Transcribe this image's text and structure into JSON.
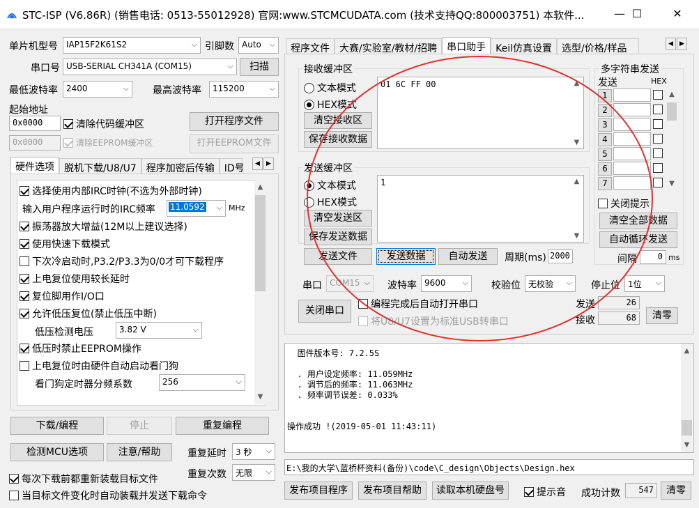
{
  "window": {
    "title": "STC-ISP (V6.86R) (销售电话: 0513-55012928) 官网:www.STCMCUDATA.com  (技术支持QQ:800003751) 本软件...",
    "min": "—",
    "max": "☐",
    "close": "✕"
  },
  "left": {
    "mcu_label": "单片机型号",
    "mcu_value": "IAP15F2K61S2",
    "pins_label": "引脚数",
    "pins_value": "Auto",
    "port_label": "串口号",
    "port_value": "USB-SERIAL CH341A (COM15)",
    "scan": "扫描",
    "min_baud_label": "最低波特率",
    "min_baud": "2400",
    "max_baud_label": "最高波特率",
    "max_baud": "115200",
    "start_addr_label": "起始地址",
    "addr1": "0x0000",
    "clear_code": "清除代码缓冲区",
    "open_prog": "打开程序文件",
    "addr2": "0x0000",
    "clear_eeprom": "清除EEPROM缓冲区",
    "open_eeprom": "打开EEPROM文件",
    "tabs": [
      "硬件选项",
      "脱机下载/U8/U7",
      "程序加密后传输",
      "ID号"
    ],
    "options": [
      {
        "label": "选择使用内部IRC时钟(不选为外部时钟)",
        "checked": true
      },
      {
        "label": "振荡器放大增益(12M以上建议选择)",
        "checked": true
      },
      {
        "label": "使用快速下载模式",
        "checked": true
      },
      {
        "label": "下次冷启动时,P3.2/P3.3为0/0才可下载程序",
        "checked": false
      },
      {
        "label": "上电复位使用较长延时",
        "checked": true
      },
      {
        "label": "复位脚用作I/O口",
        "checked": true
      },
      {
        "label": "允许低压复位(禁止低压中断)",
        "checked": true
      },
      {
        "label": "低压时禁止EEPROM操作",
        "checked": true
      },
      {
        "label": "上电复位时由硬件自动启动看门狗",
        "checked": false
      }
    ],
    "irc_label": "输入用户程序运行时的IRC频率",
    "irc_value": "11.0592",
    "irc_unit": "MHz",
    "lv_label": "低压检测电压",
    "lv_value": "3.82 V",
    "wdt_label": "看门狗定时器分频系数",
    "wdt_value": "256",
    "download": "下载/编程",
    "stop": "停止",
    "reprogram": "重复编程",
    "check_mcu": "检测MCU选项",
    "help": "注意/帮助",
    "delay_label": "重复延时",
    "delay_value": "3 秒",
    "times_label": "重复次数",
    "times_value": "无限",
    "reload": "每次下载前都重新装载目标文件",
    "auto_send": "当目标文件变化时自动装载并发送下载命令"
  },
  "right": {
    "tabs": [
      "程序文件",
      "大赛/实验室/教材/招聘",
      "串口助手",
      "Keil仿真设置",
      "选型/价格/样品"
    ],
    "recv_group": "接收缓冲区",
    "recv_text": "文本模式",
    "recv_hex": "HEX模式",
    "recv_clear": "清空接收区",
    "recv_save": "保存接收数据",
    "recv_data": "01 6C FF 00",
    "send_group": "发送缓冲区",
    "send_text": "文本模式",
    "send_hex": "HEX模式",
    "send_clear": "清空发送区",
    "send_save": "保存发送数据",
    "send_data": "1",
    "send_file": "发送文件",
    "send_data_btn": "发送数据",
    "auto_send": "自动发送",
    "period_label": "周期(ms)",
    "period_value": "2000",
    "multi_title": "多字符串发送",
    "multi_send": "发送",
    "multi_hex": "HEX",
    "multi_rows": [
      "1",
      "2",
      "3",
      "4",
      "5",
      "6",
      "7"
    ],
    "close_tip": "关闭提示",
    "clear_all": "清空全部数据",
    "auto_loop": "自动循环发送",
    "interval_label": "间隔",
    "interval_value": "0",
    "interval_unit": "ms",
    "port_label": "串口",
    "port_value": "COM15",
    "baud_label": "波特率",
    "baud_value": "9600",
    "parity_label": "校验位",
    "parity_value": "无校验",
    "stop_label": "停止位",
    "stop_value": "1位",
    "close_port": "关闭串口",
    "auto_open": "编程完成后自动打开串口",
    "usb_set": "将U8/U7设置为标准USB转串口",
    "sent_label": "发送",
    "sent_value": "26",
    "recv_label": "接收",
    "recv_value": "68",
    "reset": "清零"
  },
  "log": {
    "lines": [
      "  固件版本号: 7.2.5S",
      "",
      "  . 用户设定频率: 11.059MHz",
      "  . 调节后的频率: 11.063MHz",
      "  . 频率调节误差: 0.033%",
      "",
      "",
      "操作成功 !(2019-05-01 11:43:11)"
    ],
    "path": "E:\\我的大学\\蓝桥杯资料(备份)\\code\\C_design\\Objects\\Design.hex"
  },
  "bottom": {
    "publish_prog": "发布项目程序",
    "publish_help": "发布项目帮助",
    "read_disk": "读取本机硬盘号",
    "beep": "提示音",
    "success_label": "成功计数",
    "success_value": "547",
    "reset": "清零"
  }
}
